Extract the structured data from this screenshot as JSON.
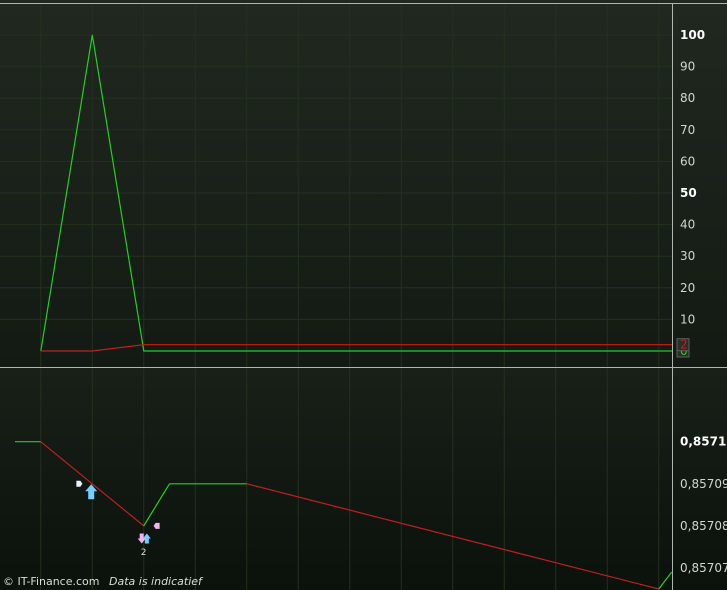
{
  "footer": {
    "brand": "© IT-Finance.com",
    "note": "Data is indicatief"
  },
  "colors": {
    "up": "#1fd21f",
    "down": "#c41e1e",
    "grid": "#23301f",
    "frame": "#aeb6ae"
  },
  "chart_data": [
    {
      "type": "line",
      "ylim": [
        0,
        100
      ],
      "y_ticks": [
        "100",
        "90",
        "80",
        "70",
        "60",
        "50",
        "40",
        "30",
        "20",
        "10"
      ],
      "y_ticks_bold": [
        "100",
        "50"
      ],
      "series": [
        {
          "color": "#1fd21f",
          "x": [
            1,
            2,
            3,
            4,
            5,
            6,
            7,
            8,
            9,
            10,
            11,
            12,
            13
          ],
          "values": [
            0,
            100,
            0,
            0,
            0,
            0,
            0,
            0,
            0,
            0,
            0,
            0,
            0
          ],
          "last_label": "0"
        },
        {
          "color": "#c41e1e",
          "x": [
            1,
            2,
            3,
            4,
            5,
            6,
            7,
            8,
            9,
            10,
            11,
            12,
            13
          ],
          "values": [
            0,
            0,
            2,
            2,
            2,
            2,
            2,
            2,
            2,
            2,
            2,
            2,
            2
          ],
          "last_label": "2"
        }
      ]
    },
    {
      "type": "line",
      "ylim": [
        0.857065,
        0.857113
      ],
      "y_ticks": [
        "0,8571",
        "0,85709",
        "0,85708",
        "0,85707"
      ],
      "y_ticks_bold": [
        "0,8571"
      ],
      "x": [
        0.5,
        1,
        2,
        3,
        3.5,
        5,
        13,
        13.25
      ],
      "values": [
        0.8571,
        0.8571,
        0.85709,
        0.85708,
        0.85709,
        0.85709,
        0.857065,
        0.857069
      ],
      "annotations": [
        {
          "kind": "marker-right",
          "x": 1.75,
          "y": 0.85709,
          "color": "#e8f2ff"
        },
        {
          "kind": "buy-arrow",
          "x": 1.98,
          "y": 0.857088,
          "color": "#74d0ff"
        },
        {
          "kind": "sell-arrow",
          "x": 2.96,
          "y": 0.857077,
          "color": "#f3b2f2"
        },
        {
          "kind": "buy-arrow-small",
          "x": 3.06,
          "y": 0.857077,
          "color": "#74d0ff"
        },
        {
          "kind": "marker-left",
          "x": 3.25,
          "y": 0.85708,
          "color": "#f3b2f2"
        },
        {
          "kind": "count",
          "x": 3.0,
          "y": 0.857074,
          "text": "2",
          "color": "#d8d8d8"
        }
      ]
    }
  ]
}
